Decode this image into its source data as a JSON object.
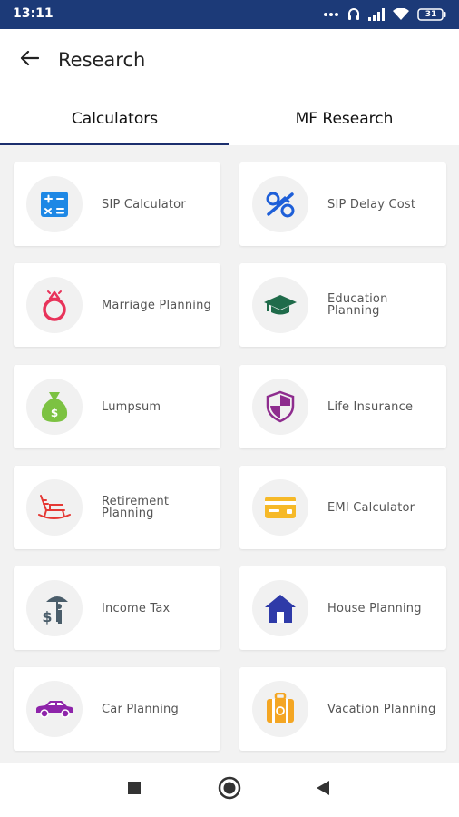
{
  "status_bar": {
    "time": "13:11",
    "battery": "31",
    "icons": [
      "dots-icon",
      "headset-icon",
      "signal-icon",
      "wifi-icon",
      "battery-icon"
    ]
  },
  "header": {
    "title": "Research",
    "back_icon": "back-arrow-icon"
  },
  "tabs": [
    {
      "label": "Calculators",
      "active": true
    },
    {
      "label": "MF Research",
      "active": false
    }
  ],
  "calculators": [
    {
      "label": "SIP Calculator",
      "icon": "calculator-icon",
      "color": "#1e88e5"
    },
    {
      "label": "SIP Delay Cost",
      "icon": "delay-cost-icon",
      "color": "#1e5fd8"
    },
    {
      "label": "Marriage Planning",
      "icon": "ring-icon",
      "color": "#e8335a"
    },
    {
      "label": "Education Planning",
      "icon": "graduation-cap-icon",
      "color": "#1f6b4a"
    },
    {
      "label": "Lumpsum",
      "icon": "money-bag-icon",
      "color": "#7cc242"
    },
    {
      "label": "Life Insurance",
      "icon": "shield-icon",
      "color": "#8e2c8e"
    },
    {
      "label": "Retirement Planning",
      "icon": "rocking-chair-icon",
      "color": "#e53935"
    },
    {
      "label": "EMI Calculator",
      "icon": "card-icon",
      "color": "#f6b928"
    },
    {
      "label": "Income Tax",
      "icon": "umbrella-dollar-icon",
      "color": "#4a5d6a"
    },
    {
      "label": "House Planning",
      "icon": "house-icon",
      "color": "#2e3aa8"
    },
    {
      "label": "Car Planning",
      "icon": "car-icon",
      "color": "#8e24aa"
    },
    {
      "label": "Vacation Planning",
      "icon": "suitcase-icon",
      "color": "#f4a623"
    }
  ],
  "nav_bar": {
    "buttons": [
      "recents-square-icon",
      "home-circle-icon",
      "back-triangle-icon"
    ]
  }
}
